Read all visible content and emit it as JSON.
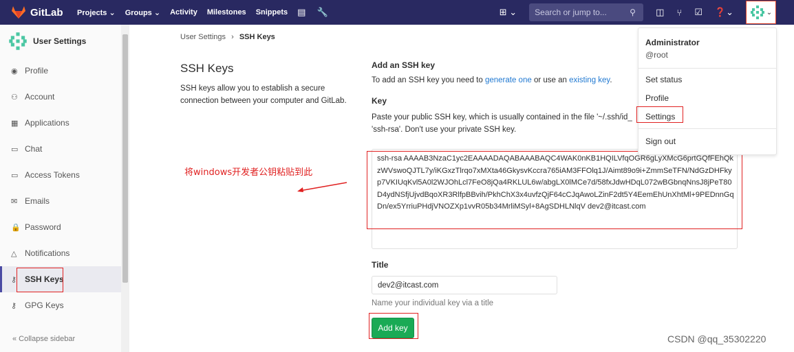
{
  "topbar": {
    "brand": "GitLab",
    "nav": [
      "Projects ⌄",
      "Groups ⌄",
      "Activity",
      "Milestones",
      "Snippets"
    ],
    "search_placeholder": "Search or jump to...",
    "colors": {
      "bg": "#292961",
      "accent": "#e24329"
    }
  },
  "sidebar": {
    "title": "User Settings",
    "items": [
      {
        "label": "Profile",
        "icon": "user-circle-icon"
      },
      {
        "label": "Account",
        "icon": "users-icon"
      },
      {
        "label": "Applications",
        "icon": "apps-grid-icon"
      },
      {
        "label": "Chat",
        "icon": "chat-icon"
      },
      {
        "label": "Access Tokens",
        "icon": "token-icon"
      },
      {
        "label": "Emails",
        "icon": "envelope-icon"
      },
      {
        "label": "Password",
        "icon": "lock-icon"
      },
      {
        "label": "Notifications",
        "icon": "bell-icon"
      },
      {
        "label": "SSH Keys",
        "icon": "key-icon",
        "active": true
      },
      {
        "label": "GPG Keys",
        "icon": "key-icon"
      }
    ],
    "collapse": "« Collapse sidebar"
  },
  "breadcrumb": {
    "root": "User Settings",
    "sep": "›",
    "current": "SSH Keys"
  },
  "intro": {
    "title": "SSH Keys",
    "desc": "SSH keys allow you to establish a secure connection between your computer and GitLab."
  },
  "form": {
    "add_heading": "Add an SSH key",
    "add_prefix": "To add an SSH key you need to ",
    "link_generate": "generate one",
    "add_mid": " or use an ",
    "link_existing": "existing key",
    "add_suffix": ".",
    "key_label": "Key",
    "key_help": "Paste your public SSH key, which is usually contained in the file '~/.ssh/id_",
    "key_help2": "'ssh-rsa'. Don't use your private SSH key.",
    "key_value": "ssh-rsa AAAAB3NzaC1yc2EAAAADAQABAAABAQC4WAK0nKB1HQILVfqOGR6gLyXMcG6prtGQfFEhQkzWVswoQJTL7y/iKGxzTlrqo7xMXta46GkysvKccra765iAM3FFOlq1J/Aimt89o9i+ZmmSeTFN/NdGzDHFkyp7VKIUqKvl5A0l2WJOhLcl7FeO8jQa4RKLUL6w/abgLX0lMCe7d/58fxJdwHDqL072wBGbnqNnsJ8jPeT80D4ydNSfjUjvdBqoXR3RlfpBBvih/PkhChX3x4uvfzQjF64cCJqAwoLZinF2dt5Y4EemEhUnXhtMl+9PEDnnGqDn/ex5YrriuPHdjVNOZXp1vvR05b34MrliMSyl+8AgSDHLNlqV dev2@itcast.com",
    "title_label": "Title",
    "title_value": "dev2@itcast.com",
    "title_help": "Name your individual key via a title",
    "submit": "Add key"
  },
  "dropdown": {
    "name": "Administrator",
    "handle": "@root",
    "items": [
      "Set status",
      "Profile",
      "Settings",
      "Sign out"
    ]
  },
  "annotation": "将windows开发者公钥粘贴到此",
  "watermark": "CSDN @qq_35302220"
}
